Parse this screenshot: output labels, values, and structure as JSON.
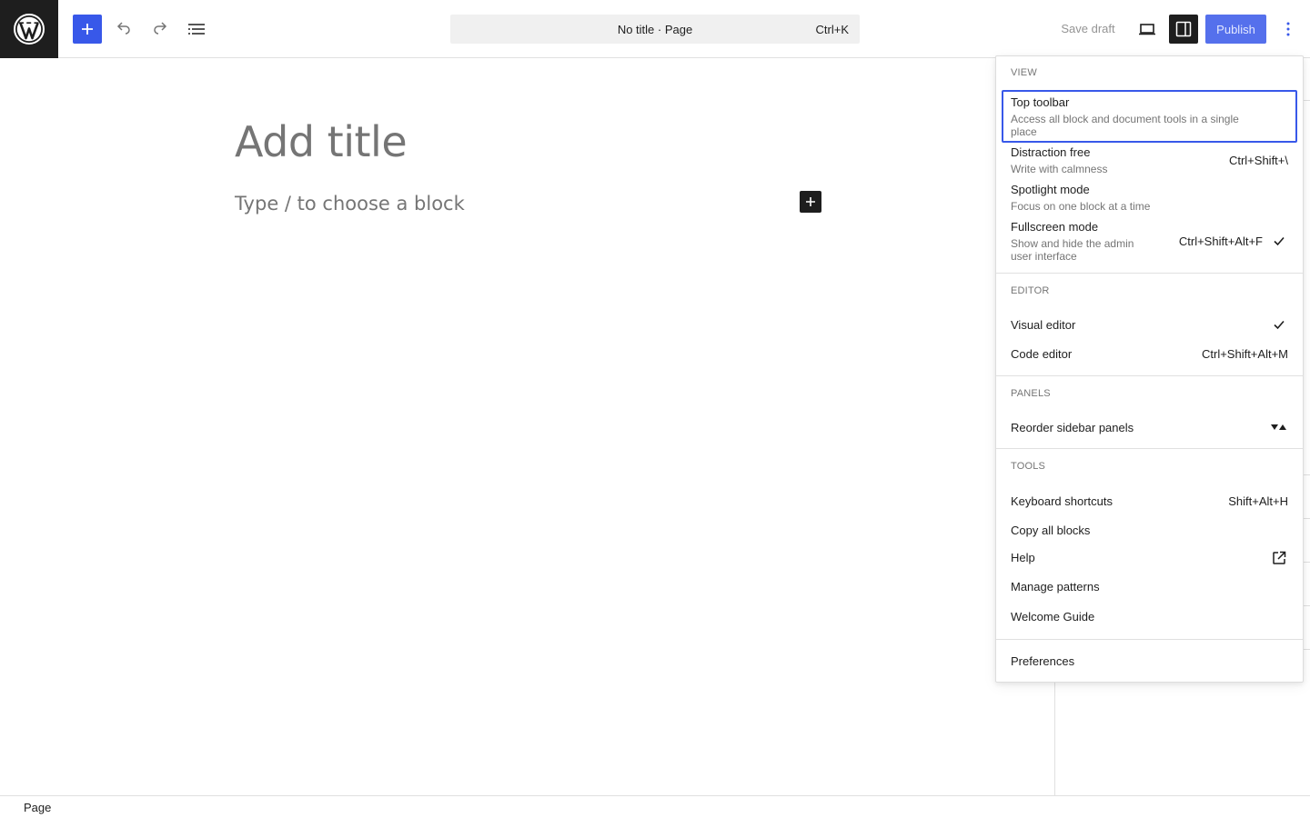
{
  "header": {
    "command_center_title": "No title · Page",
    "command_center_shortcut": "Ctrl+K",
    "save_draft_label": "Save draft",
    "publish_label": "Publish"
  },
  "editor": {
    "title_placeholder": "Add title",
    "block_placeholder": "Type / to choose a block"
  },
  "footer": {
    "breadcrumb": "Page"
  },
  "options_menu": {
    "view": {
      "label": "View",
      "items": [
        {
          "label": "Top toolbar",
          "description": "Access all block and document tools in a single place",
          "shortcut": ""
        },
        {
          "label": "Distraction free",
          "description": "Write with calmness",
          "shortcut": "Ctrl+Shift+\\"
        },
        {
          "label": "Spotlight mode",
          "description": "Focus on one block at a time",
          "shortcut": ""
        },
        {
          "label": "Fullscreen mode",
          "description": "Show and hide the admin user interface",
          "shortcut": "Ctrl+Shift+Alt+F",
          "checked": true
        }
      ]
    },
    "editor": {
      "label": "Editor",
      "items": [
        {
          "label": "Visual editor",
          "shortcut": "",
          "checked": true
        },
        {
          "label": "Code editor",
          "shortcut": "Ctrl+Shift+Alt+M"
        }
      ]
    },
    "panels": {
      "label": "Panels",
      "items": [
        {
          "label": "Reorder sidebar panels",
          "icon": "reorder-arrows-icon"
        }
      ]
    },
    "tools": {
      "label": "Tools",
      "items": [
        {
          "label": "Keyboard shortcuts",
          "shortcut": "Shift+Alt+H"
        },
        {
          "label": "Copy all blocks",
          "shortcut": ""
        },
        {
          "label": "Help",
          "icon": "external-link-icon"
        },
        {
          "label": "Manage patterns",
          "shortcut": ""
        },
        {
          "label": "Welcome Guide",
          "shortcut": ""
        }
      ]
    },
    "preferences": {
      "label": "Preferences"
    }
  },
  "colors": {
    "accent": "#3858e9",
    "dark": "#1e1e1e",
    "muted": "#757575"
  }
}
